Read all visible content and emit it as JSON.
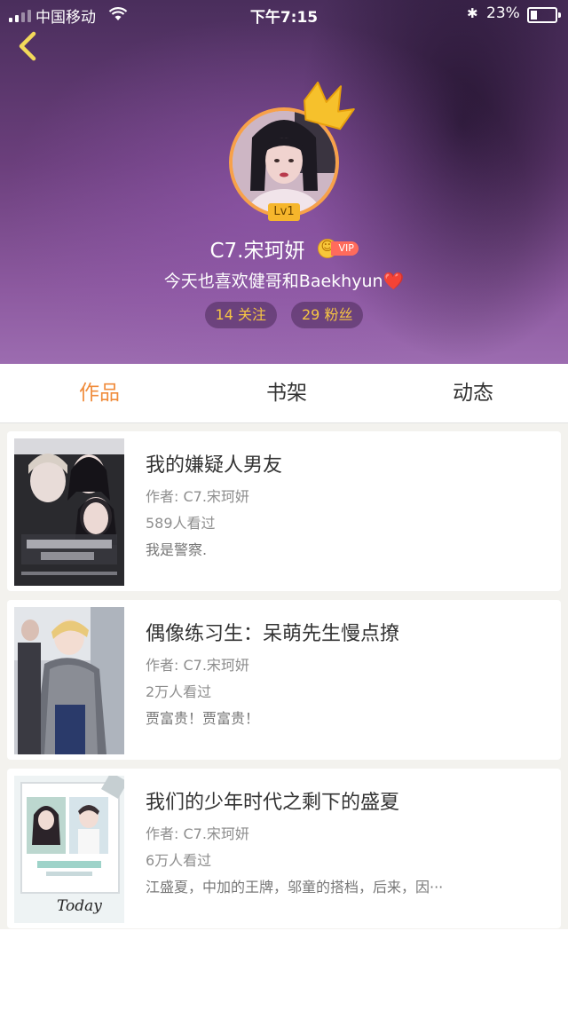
{
  "status_bar": {
    "carrier": "中国移动",
    "time": "下午7:15",
    "battery": "23%"
  },
  "profile": {
    "level": "Lv1",
    "name": "C7.宋珂妍",
    "vip_label": "VIP",
    "bio": "今天也喜欢健哥和Baekhyun",
    "bio_emoji": "❤️",
    "following": "14 关注",
    "followers": "29 粉丝"
  },
  "tabs": [
    {
      "label": "作品",
      "active": true
    },
    {
      "label": "书架",
      "active": false
    },
    {
      "label": "动态",
      "active": false
    }
  ],
  "books": [
    {
      "title": "我的嫌疑人男友",
      "author": "作者: C7.宋珂妍",
      "views": "589人看过",
      "description": "我是警察."
    },
    {
      "title": "偶像练习生：呆萌先生慢点撩",
      "author": "作者: C7.宋珂妍",
      "views": "2万人看过",
      "description": "贾富贵！贾富贵！"
    },
    {
      "title": "我们的少年时代之剩下的盛夏",
      "author": "作者: C7.宋珂妍",
      "views": "6万人看过",
      "description": "江盛夏，中加的王牌，邬童的搭档，后来，因···"
    }
  ],
  "colors": {
    "accent": "#f08c3c",
    "stat_text": "#f6c543",
    "level_badge": "#f6b62c"
  }
}
